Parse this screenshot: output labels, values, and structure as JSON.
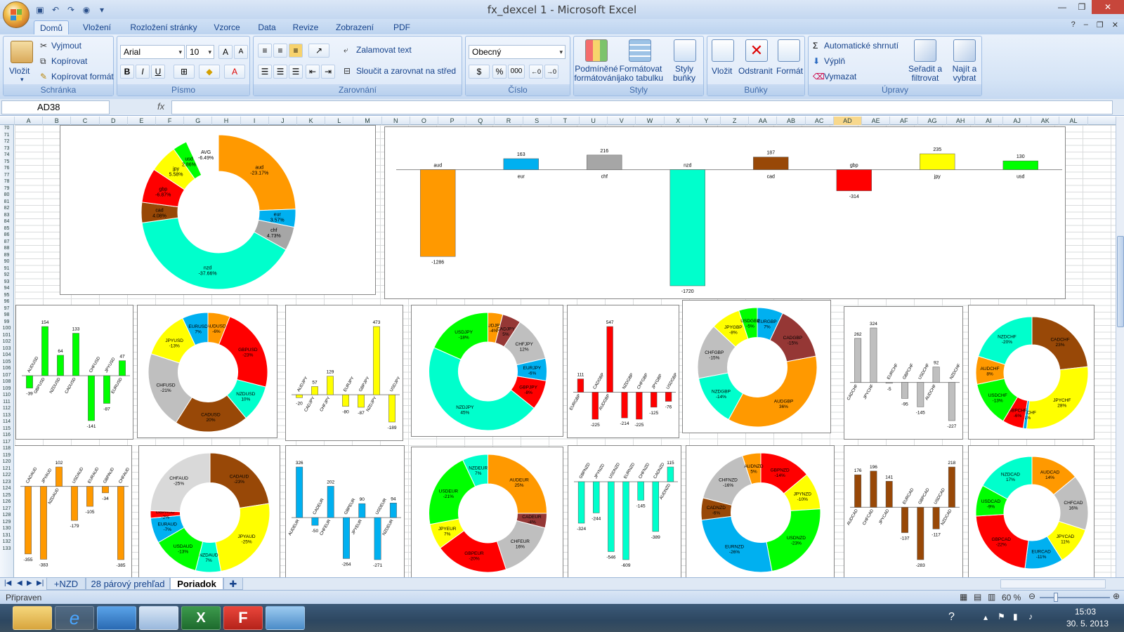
{
  "window": {
    "title": "fx_dexcel 1 - Microsoft Excel"
  },
  "ribbon_tabs": [
    "Domů",
    "Vložení",
    "Rozložení stránky",
    "Vzorce",
    "Data",
    "Revize",
    "Zobrazení",
    "PDF"
  ],
  "clipboard": {
    "paste": "Vložit",
    "cut": "Vyjmout",
    "copy": "Kopírovat",
    "format_painter": "Kopírovat formát",
    "label": "Schránka"
  },
  "font": {
    "name": "Arial",
    "size": "10",
    "bold": "B",
    "italic": "I",
    "underline": "U",
    "label": "Písmo"
  },
  "alignment": {
    "wrap": "Zalamovat text",
    "merge": "Sloučit a zarovnat na střed",
    "label": "Zarovnání"
  },
  "number": {
    "format": "Obecný",
    "percent": "%",
    "thousands": "000",
    "label": "Číslo"
  },
  "styles": {
    "conditional": "Podmíněné formátování",
    "table": "Formátovat jako tabulku",
    "cell": "Styly buňky",
    "label": "Styly"
  },
  "cells": {
    "insert": "Vložit",
    "delete": "Odstranit",
    "format": "Formát",
    "label": "Buňky"
  },
  "editing": {
    "autosum": "Automatické shrnutí",
    "fill": "Výplň",
    "clear": "Vymazat",
    "sort": "Seřadit a filtrovat",
    "find": "Najít a vybrat",
    "label": "Úpravy"
  },
  "formula_bar": {
    "name_box": "AD38",
    "fx": "fx",
    "value": ""
  },
  "columns": [
    "A",
    "B",
    "C",
    "D",
    "E",
    "F",
    "G",
    "H",
    "I",
    "J",
    "K",
    "L",
    "M",
    "N",
    "O",
    "P",
    "Q",
    "R",
    "S",
    "T",
    "U",
    "V",
    "W",
    "X",
    "Y",
    "Z",
    "AA",
    "AB",
    "AC",
    "AD",
    "AE",
    "AF",
    "AG",
    "AH",
    "AI",
    "AJ",
    "AK",
    "AL"
  ],
  "row_start": 70,
  "row_end": 133,
  "sheets": [
    "+NZD",
    "28 párový prehľad",
    "Poriadok"
  ],
  "active_sheet": "Poriadok",
  "status": {
    "ready": "Připraven",
    "zoom": "60 %"
  },
  "clock": {
    "time": "15:03",
    "date": "30. 5. 2013"
  },
  "colors": {
    "aud": "#ff9900",
    "eur": "#00b0f0",
    "chf": "#a6a6a6",
    "nzd": "#00ffcc",
    "cad": "#984807",
    "gbp": "#ff0000",
    "jpy": "#ffff00",
    "usd": "#00ff00",
    "avg": "#ffffff"
  },
  "chart_data": [
    {
      "type": "pie",
      "id": "main-donut",
      "labels": [
        "aud",
        "eur",
        "chf",
        "nzd",
        "cad",
        "gbp",
        "jpy",
        "usd",
        "AVG"
      ],
      "values": [
        23.17,
        3.57,
        4.73,
        37.66,
        4.08,
        6.87,
        5.58,
        2.86,
        6.49
      ],
      "value_labels": [
        "-23.17%",
        "3.57%",
        "4.73%",
        "-37.66%",
        "4.08%",
        "-6.87%",
        "5.58%",
        "2.86%",
        "-6.49%"
      ],
      "colors": [
        "#ff9900",
        "#00b0f0",
        "#a6a6a6",
        "#00ffcc",
        "#984807",
        "#ff0000",
        "#ffff00",
        "#00ff00",
        "#ffffff"
      ]
    },
    {
      "type": "bar",
      "id": "main-bar",
      "categories": [
        "aud",
        "eur",
        "chf",
        "nzd",
        "cad",
        "gbp",
        "jpy",
        "usd"
      ],
      "values": [
        -1286,
        163,
        216,
        -1720,
        187,
        -314,
        235,
        130
      ],
      "colors": [
        "#ff9900",
        "#00b0f0",
        "#a6a6a6",
        "#00ffcc",
        "#984807",
        "#ff0000",
        "#ffff00",
        "#00ff00"
      ],
      "ylim": [
        -1720,
        235
      ]
    },
    {
      "type": "bar",
      "id": "usd-bar",
      "categories": [
        "AUDUSD",
        "GBPUSD",
        "NZDUSD",
        "CADUSD",
        "CHFUSD",
        "JPYUSD",
        "EURUSD"
      ],
      "values": [
        -39,
        154,
        64,
        133,
        -141,
        -87,
        47
      ],
      "color": "#00ff00"
    },
    {
      "type": "pie",
      "id": "usd-donut",
      "labels": [
        "AUDUSD",
        "GBPUSD",
        "NZDUSD",
        "CADUSD",
        "CHFUSD",
        "JPYUSD",
        "EURUSD"
      ],
      "values": [
        6,
        23,
        10,
        20,
        21,
        13,
        7
      ],
      "value_labels": [
        "-6%",
        "-23%",
        "10%",
        "20%",
        "-21%",
        "-13%",
        "7%"
      ],
      "colors": [
        "#ff9900",
        "#ff0000",
        "#00ffcc",
        "#984807",
        "#bfbfbf",
        "#ffff00",
        "#00b0f0"
      ]
    },
    {
      "type": "bar",
      "id": "jpy-bar",
      "categories": [
        "AUDJPY",
        "CADJPY",
        "CHFJPY",
        "EURJPY",
        "GBPJPY",
        "NZDJPY",
        "USDJPY"
      ],
      "values": [
        -20,
        57,
        129,
        -80,
        -87,
        473,
        -189
      ],
      "color": "#ffff00"
    },
    {
      "type": "pie",
      "id": "jpy-donut",
      "labels": [
        "AUDJPY",
        "CADJPY",
        "CHFJPY",
        "EURJPY",
        "GBPJPY",
        "NZDJPY",
        "USDJPY"
      ],
      "values": [
        4,
        5,
        12,
        6,
        8,
        45,
        18
      ],
      "value_labels": [
        "-4%",
        "5%",
        "12%",
        "-6%",
        "-8%",
        "45%",
        "-18%"
      ],
      "colors": [
        "#ff9900",
        "#953735",
        "#bfbfbf",
        "#00b0f0",
        "#ff0000",
        "#00ffcc",
        "#00ff00"
      ]
    },
    {
      "type": "bar",
      "id": "gbp-bar",
      "categories": [
        "EURGBP",
        "CADGBP",
        "AUDGBP",
        "NZDGBP",
        "CHFGBP",
        "JPYGBP",
        "USDGBP"
      ],
      "values": [
        111,
        -225,
        547,
        -214,
        -225,
        -125,
        -76
      ],
      "color": "#ff0000"
    },
    {
      "type": "pie",
      "id": "gbp-donut",
      "labels": [
        "EURGBP",
        "CADGBP",
        "AUDGBP",
        "NZDGBP",
        "CHFGBP",
        "JPYGBP",
        "USDGBP"
      ],
      "values": [
        7,
        15,
        36,
        14,
        15,
        8,
        5
      ],
      "value_labels": [
        "7%",
        "-15%",
        "36%",
        "-14%",
        "-15%",
        "-8%",
        "-5%"
      ],
      "colors": [
        "#00b0f0",
        "#953735",
        "#ff9900",
        "#00ffcc",
        "#bfbfbf",
        "#ffff00",
        "#00ff00"
      ]
    },
    {
      "type": "bar",
      "id": "chf-bar",
      "categories": [
        "CADCHF",
        "JPYCHF",
        "EURCHF",
        "GBPCHF",
        "USDCHF",
        "AUDCHF",
        "NZDCHF"
      ],
      "values": [
        262,
        324,
        -5,
        -95,
        -145,
        92,
        -227
      ],
      "color": "#bfbfbf"
    },
    {
      "type": "pie",
      "id": "chf-donut",
      "labels": [
        "CADCHF",
        "JPYCHF",
        "EURCHF",
        "GBPCHF",
        "USDCHF",
        "AUDCHF",
        "NZDCHF"
      ],
      "values": [
        23,
        28,
        1,
        6,
        13,
        8,
        20
      ],
      "value_labels": [
        "23%",
        "28%",
        "-1%",
        "-6%",
        "-13%",
        "8%",
        "-20%"
      ],
      "colors": [
        "#984807",
        "#ffff00",
        "#00b0f0",
        "#ff0000",
        "#00ff00",
        "#ff9900",
        "#00ffcc"
      ]
    },
    {
      "type": "bar",
      "id": "aud-bar",
      "categories": [
        "CADAUD",
        "JPYAUD",
        "NZDAUD",
        "USDAUD",
        "EURAUD",
        "GBPAUD",
        "CHFAUD"
      ],
      "values": [
        -355,
        -383,
        102,
        -179,
        -105,
        -34,
        -385
      ],
      "color": "#ff9900"
    },
    {
      "type": "pie",
      "id": "aud-donut",
      "labels": [
        "CADAUD",
        "JPYAUD",
        "NZDAUD",
        "USDAUD",
        "EURAUD",
        "GBPAUD",
        "CHFAUD"
      ],
      "values": [
        23,
        25,
        7,
        13,
        7,
        2,
        25
      ],
      "value_labels": [
        "-23%",
        "-25%",
        "7%",
        "-13%",
        "-7%",
        "-2%",
        "-25%"
      ],
      "colors": [
        "#984807",
        "#ffff00",
        "#00ffcc",
        "#00ff00",
        "#00b0f0",
        "#ff0000",
        "#d9d9d9"
      ]
    },
    {
      "type": "bar",
      "id": "eur-bar",
      "categories": [
        "AUDEUR",
        "CADEUR",
        "CHFEUR",
        "GBPEUR",
        "JPYEUR",
        "USDEUR",
        "NZDEUR"
      ],
      "values": [
        326,
        -50,
        202,
        -264,
        90,
        -271,
        94
      ],
      "color": "#00b0f0"
    },
    {
      "type": "pie",
      "id": "eur-donut",
      "labels": [
        "AUDEUR",
        "CADEUR",
        "CHFEUR",
        "GBPEUR",
        "JPYEUR",
        "USDEUR",
        "NZDEUR"
      ],
      "values": [
        25,
        4,
        16,
        20,
        7,
        21,
        7
      ],
      "value_labels": [
        "25%",
        "-4%",
        "16%",
        "-20%",
        "7%",
        "-21%",
        "7%"
      ],
      "colors": [
        "#ff9900",
        "#953735",
        "#bfbfbf",
        "#ff0000",
        "#ffff00",
        "#00ff00",
        "#00ffcc"
      ]
    },
    {
      "type": "bar",
      "id": "nzd-bar",
      "categories": [
        "GBPNZD",
        "JPYNZD",
        "USDNZD",
        "EURNZD",
        "CHFNZD",
        "CADNZD",
        "AUDNZD"
      ],
      "values": [
        -324,
        -244,
        -546,
        -609,
        -145,
        -389,
        115
      ],
      "color": "#00ffcc"
    },
    {
      "type": "pie",
      "id": "nzd-donut",
      "labels": [
        "GBPNZD",
        "JPYNZD",
        "USDNZD",
        "EURNZD",
        "CADNZD",
        "CHFNZD",
        "AUDNZD"
      ],
      "values": [
        14,
        10,
        23,
        26,
        6,
        16,
        5
      ],
      "value_labels": [
        "-14%",
        "-10%",
        "-23%",
        "-26%",
        "-6%",
        "-16%",
        "5%"
      ],
      "colors": [
        "#ff0000",
        "#ffff00",
        "#00ff00",
        "#00b0f0",
        "#984807",
        "#bfbfbf",
        "#ff9900"
      ]
    },
    {
      "type": "bar",
      "id": "cad-bar",
      "categories": [
        "AUDCAD",
        "CHFCAD",
        "JPYCAD",
        "EURCAD",
        "GBPCAD",
        "USDCAD",
        "NZDCAD"
      ],
      "values": [
        176,
        196,
        141,
        -137,
        -283,
        -117,
        218
      ],
      "color": "#984807"
    },
    {
      "type": "pie",
      "id": "cad-donut",
      "labels": [
        "AUDCAD",
        "CHFCAD",
        "JPYCAD",
        "EURCAD",
        "GBPCAD",
        "USDCAD",
        "NZDCAD"
      ],
      "values": [
        14,
        16,
        11,
        11,
        22,
        9,
        17
      ],
      "value_labels": [
        "14%",
        "16%",
        "11%",
        "-11%",
        "-22%",
        "-9%",
        "17%"
      ],
      "colors": [
        "#ff9900",
        "#bfbfbf",
        "#ffff00",
        "#00b0f0",
        "#ff0000",
        "#00ff00",
        "#00ffcc"
      ]
    }
  ]
}
